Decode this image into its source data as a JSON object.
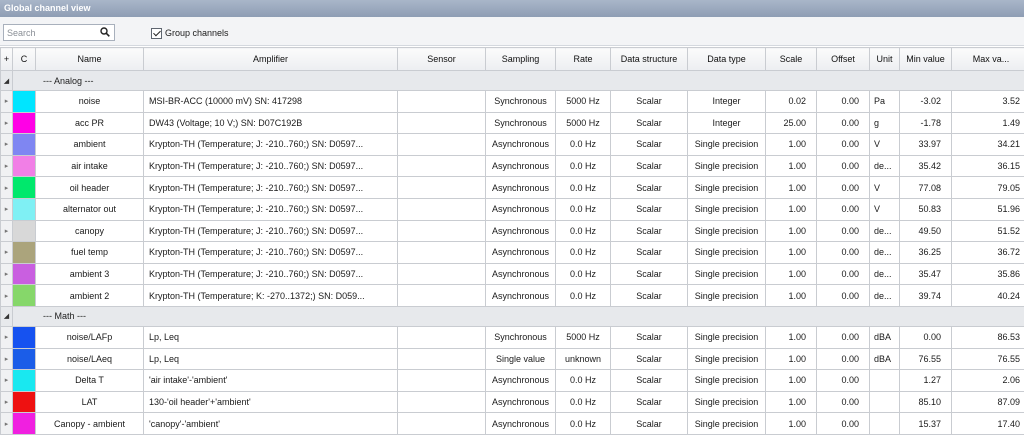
{
  "window": {
    "title": "Global channel view"
  },
  "toolbar": {
    "search_placeholder": "Search",
    "group_channels_label": "Group channels",
    "group_channels_checked": true
  },
  "table": {
    "headers": {
      "add": "+",
      "color": "C",
      "name": "Name",
      "amplifier": "Amplifier",
      "sensor": "Sensor",
      "sampling": "Sampling",
      "rate": "Rate",
      "data_structure": "Data structure",
      "data_type": "Data type",
      "scale": "Scale",
      "offset": "Offset",
      "unit": "Unit",
      "min": "Min value",
      "max": "Max va..."
    },
    "groups": [
      {
        "label": "--- Analog ---",
        "rows": [
          {
            "color": "#00e5ff",
            "name": "noise",
            "amplifier": "MSI-BR-ACC (10000 mV) SN: 417298",
            "sensor": "",
            "sampling": "Synchronous",
            "rate": "5000 Hz",
            "structure": "Scalar",
            "type": "Integer",
            "scale": "0.02",
            "offset": "0.00",
            "unit": "Pa",
            "min": "-3.02",
            "max": "3.52"
          },
          {
            "color": "#ff00e6",
            "name": "acc PR",
            "amplifier": "DW43 (Voltage; 10 V;) SN: D07C192B",
            "sensor": "",
            "sampling": "Synchronous",
            "rate": "5000 Hz",
            "structure": "Scalar",
            "type": "Integer",
            "scale": "25.00",
            "offset": "0.00",
            "unit": "g",
            "min": "-1.78",
            "max": "1.49"
          },
          {
            "color": "#7f86f2",
            "name": "ambient",
            "amplifier": "Krypton-TH (Temperature; J: -210..760;) SN: D0597...",
            "sensor": "",
            "sampling": "Asynchronous",
            "rate": "0.0 Hz",
            "structure": "Scalar",
            "type": "Single precision",
            "scale": "1.00",
            "offset": "0.00",
            "unit": "V",
            "min": "33.97",
            "max": "34.21"
          },
          {
            "color": "#f17fe6",
            "name": "air intake",
            "amplifier": "Krypton-TH (Temperature; J: -210..760;) SN: D0597...",
            "sensor": "",
            "sampling": "Asynchronous",
            "rate": "0.0 Hz",
            "structure": "Scalar",
            "type": "Single precision",
            "scale": "1.00",
            "offset": "0.00",
            "unit": "de...",
            "min": "35.42",
            "max": "36.15"
          },
          {
            "color": "#00e86c",
            "name": "oil header",
            "amplifier": "Krypton-TH (Temperature; J: -210..760;) SN: D0597...",
            "sensor": "",
            "sampling": "Asynchronous",
            "rate": "0.0 Hz",
            "structure": "Scalar",
            "type": "Single precision",
            "scale": "1.00",
            "offset": "0.00",
            "unit": "V",
            "min": "77.08",
            "max": "79.05"
          },
          {
            "color": "#7ff0f4",
            "name": "alternator out",
            "amplifier": "Krypton-TH (Temperature; J: -210..760;) SN: D0597...",
            "sensor": "",
            "sampling": "Asynchronous",
            "rate": "0.0 Hz",
            "structure": "Scalar",
            "type": "Single precision",
            "scale": "1.00",
            "offset": "0.00",
            "unit": "V",
            "min": "50.83",
            "max": "51.96"
          },
          {
            "color": "#d8d8d8",
            "name": "canopy",
            "amplifier": "Krypton-TH (Temperature; J: -210..760;) SN: D0597...",
            "sensor": "",
            "sampling": "Asynchronous",
            "rate": "0.0 Hz",
            "structure": "Scalar",
            "type": "Single precision",
            "scale": "1.00",
            "offset": "0.00",
            "unit": "de...",
            "min": "49.50",
            "max": "51.52"
          },
          {
            "color": "#aba47c",
            "name": "fuel temp",
            "amplifier": "Krypton-TH (Temperature; J: -210..760;) SN: D0597...",
            "sensor": "",
            "sampling": "Asynchronous",
            "rate": "0.0 Hz",
            "structure": "Scalar",
            "type": "Single precision",
            "scale": "1.00",
            "offset": "0.00",
            "unit": "de...",
            "min": "36.25",
            "max": "36.72"
          },
          {
            "color": "#c95fe0",
            "name": "ambient 3",
            "amplifier": "Krypton-TH (Temperature; J: -210..760;) SN: D0597...",
            "sensor": "",
            "sampling": "Asynchronous",
            "rate": "0.0 Hz",
            "structure": "Scalar",
            "type": "Single precision",
            "scale": "1.00",
            "offset": "0.00",
            "unit": "de...",
            "min": "35.47",
            "max": "35.86"
          },
          {
            "color": "#86d76a",
            "name": "ambient 2",
            "amplifier": "Krypton-TH (Temperature; K: -270..1372;) SN: D059...",
            "sensor": "",
            "sampling": "Asynchronous",
            "rate": "0.0 Hz",
            "structure": "Scalar",
            "type": "Single precision",
            "scale": "1.00",
            "offset": "0.00",
            "unit": "de...",
            "min": "39.74",
            "max": "40.24"
          }
        ]
      },
      {
        "label": "--- Math ---",
        "rows": [
          {
            "color": "#1652f0",
            "name": "noise/LAFp",
            "amplifier": "Lp, Leq",
            "sensor": "",
            "sampling": "Synchronous",
            "rate": "5000 Hz",
            "structure": "Scalar",
            "type": "Single precision",
            "scale": "1.00",
            "offset": "0.00",
            "unit": "dBA",
            "min": "0.00",
            "max": "86.53"
          },
          {
            "color": "#1b5de8",
            "name": "noise/LAeq",
            "amplifier": "Lp, Leq",
            "sensor": "",
            "sampling": "Single value",
            "rate": "unknown",
            "structure": "Scalar",
            "type": "Single precision",
            "scale": "1.00",
            "offset": "0.00",
            "unit": "dBA",
            "min": "76.55",
            "max": "76.55"
          },
          {
            "color": "#19e8f0",
            "name": "Delta T",
            "amplifier": "'air intake'-'ambient'",
            "sensor": "",
            "sampling": "Asynchronous",
            "rate": "0.0 Hz",
            "structure": "Scalar",
            "type": "Single precision",
            "scale": "1.00",
            "offset": "0.00",
            "unit": "",
            "min": "1.27",
            "max": "2.06"
          },
          {
            "color": "#ee1111",
            "name": "LAT",
            "amplifier": "130-'oil header'+'ambient'",
            "sensor": "",
            "sampling": "Asynchronous",
            "rate": "0.0 Hz",
            "structure": "Scalar",
            "type": "Single precision",
            "scale": "1.00",
            "offset": "0.00",
            "unit": "",
            "min": "85.10",
            "max": "87.09"
          },
          {
            "color": "#f020e0",
            "name": "Canopy - ambient",
            "amplifier": "'canopy'-'ambient'",
            "sensor": "",
            "sampling": "Asynchronous",
            "rate": "0.0 Hz",
            "structure": "Scalar",
            "type": "Single precision",
            "scale": "1.00",
            "offset": "0.00",
            "unit": "",
            "min": "15.37",
            "max": "17.40"
          }
        ]
      }
    ]
  }
}
